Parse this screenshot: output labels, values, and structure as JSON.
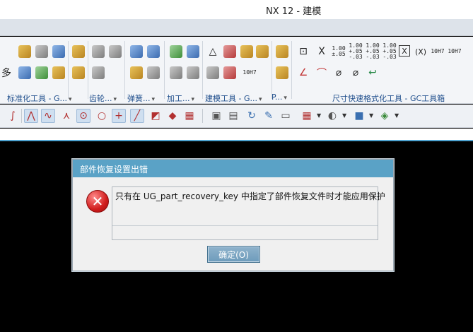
{
  "window": {
    "title": "NX 12 - 建模"
  },
  "ribbon": {
    "groups": [
      {
        "label": "标准化工具 - G...",
        "caret": "▾"
      },
      {
        "label": "齿轮...",
        "caret": "▾"
      },
      {
        "label": "弹簧...",
        "caret": "▾"
      },
      {
        "label": "加工...",
        "caret": "▾"
      },
      {
        "label": "建模工具 - G...",
        "caret": "▾"
      },
      {
        "label": "P...",
        "caret": "▾"
      },
      {
        "label": "尺寸快速格式化工具 - GC工具箱",
        "caret": ""
      }
    ],
    "dim_icons": [
      "X",
      "(X)",
      "10H7",
      "10H7"
    ],
    "tolerance_texts": [
      "1.00\n±.05",
      "1.00\n+.05\n-.03",
      "1.00\n+.05\n-.03",
      "1.00\n+.05\n-.03"
    ]
  },
  "dialog": {
    "title": "部件恢复设置出错",
    "message": "只有在 UG_part_recovery_key 中指定了部件恢复文件时才能应用保护",
    "ok_label": "确定(O)"
  },
  "colors": {
    "dialog_title_bg": "#5aa2c6",
    "ok_button_bg": "#7aa6c4",
    "error_icon": "#d11d1d"
  }
}
